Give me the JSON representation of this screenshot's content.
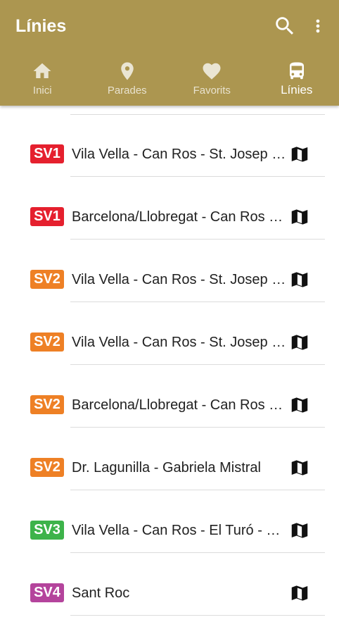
{
  "appbar": {
    "title": "Línies",
    "background_color": "#ac9650",
    "search_icon": "search-icon",
    "more_icon": "more-vert-icon"
  },
  "tabs": [
    {
      "label": "Inici",
      "icon": "home-icon",
      "active": false
    },
    {
      "label": "Parades",
      "icon": "place-icon",
      "active": false
    },
    {
      "label": "Favorits",
      "icon": "heart-icon",
      "active": false
    },
    {
      "label": "Línies",
      "icon": "bus-icon",
      "active": true
    }
  ],
  "lines": [
    {
      "code": "SV1",
      "color": "#e5202e",
      "name": "Vila Vella - Can Ros - St. Josep - Barcelona/Llobregat",
      "icon": "map-icon"
    },
    {
      "code": "SV1",
      "color": "#e5202e",
      "name": "Barcelona/Llobregat - Can Ros - St. Josep - Vila Vella",
      "icon": "map-icon"
    },
    {
      "code": "SV2",
      "color": "#ee8025",
      "name": "Vila Vella - Can Ros - St. Josep - Barcelona/Llobregat",
      "icon": "map-icon"
    },
    {
      "code": "SV2",
      "color": "#ee8025",
      "name": "Vila Vella - Can Ros - St. Josep - Barcelona/Llobregat",
      "icon": "map-icon"
    },
    {
      "code": "SV2",
      "color": "#ee8025",
      "name": "Barcelona/Llobregat - Can Ros - St. Josep - Vila Vella",
      "icon": "map-icon"
    },
    {
      "code": "SV2",
      "color": "#ee8025",
      "name": "Dr. Lagunilla - Gabriela Mistral",
      "icon": "map-icon"
    },
    {
      "code": "SV3",
      "color": "#3db34a",
      "name": "Vila Vella - Can Ros - El Turó - Can Ros - Vila Vella",
      "icon": "map-icon"
    },
    {
      "code": "SV4",
      "color": "#b4449c",
      "name": "Sant Roc",
      "icon": "map-icon"
    }
  ]
}
